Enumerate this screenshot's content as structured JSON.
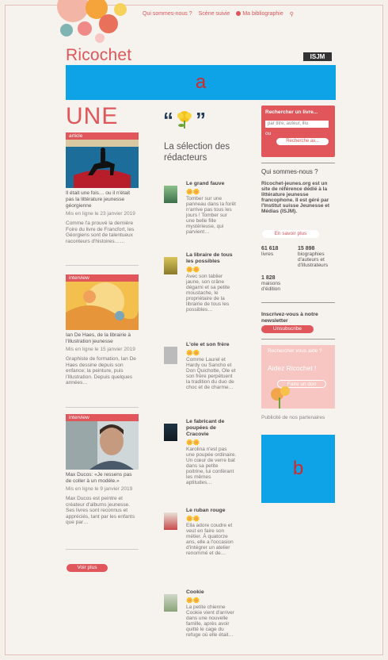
{
  "site": {
    "nav": [
      "Qui sommes-nous ?",
      "Scène suivie",
      "Ma bibliographie"
    ],
    "logo": "Ricochet",
    "partner_badge": "ISJM",
    "ad_top": "a",
    "ad_side": "b"
  },
  "une": {
    "heading": "UNE",
    "cards": [
      {
        "tag": "article",
        "title": "Il était une fois… ou il n'était pas la littérature jeunesse géorgienne",
        "date": "Mis en ligne le 23 janvier 2019",
        "desc": "Comme l'a prouvé la dernière Foire du livre de Francfort, les Géorgiens sont de talentueux raconteurs d'histoires……"
      },
      {
        "tag": "interview",
        "title": "Ian De Haes, de la librairie à l'illustration jeunesse",
        "date": "Mis en ligne le 15 janvier 2019",
        "desc": "Graphiste de formation, Ian De Haes dessine depuis son enfance; la peinture, puis l'illustration. Depuis quelques années…"
      },
      {
        "tag": "interview",
        "title": "Max Ducos: «Je ressens pas de coller à un modèle.»",
        "date": "Mis en ligne le 9 janvier 2019",
        "desc": "Max Ducos est peintre et créateur d'albums jeunesse. Ses livres sont reconnus et appréciés, tant par les enfants que par…"
      }
    ],
    "more_button": "Voir plus"
  },
  "selection": {
    "title": "La sélection des rédacteurs",
    "items": [
      {
        "title": "Le grand fauve",
        "flowers": "🌼🌼",
        "desc": "Tomber sur une panneau dans la forêt n'arrive pas tous les jours ! Tomber sur une belle fille mystérieuse, qui parvient…"
      },
      {
        "title": "La libraire de tous les possibles",
        "flowers": "🌼🌼",
        "desc": "Avec son tablier jaune, son crâne dégarni et sa petite moustache, le propriétaire de la librairie de tous les possibles…"
      },
      {
        "title": "L'ole et son frère",
        "flowers": "🌼🌼",
        "desc": "Comme Laurel et Hardy ou Sancho et Don Quichotte, Ole et son frère perpétuent la tradition du duo de choc et de charme…"
      },
      {
        "title": "Le fabricant de poupées de Cracovie",
        "flowers": "🌼🌼",
        "desc": "Karolina n'est pas une poupée ordinaire. Un cœur de verre bat dans sa petite poitrine, lui conférant les mêmes aptitudes…"
      },
      {
        "title": "Le ruban rouge",
        "flowers": "🌼🌼",
        "desc": "Ella adore coudre et veut en faire son métier. À quatorze ans, elle a l'occasion d'intégrer un atelier renommé et de…"
      },
      {
        "title": "Cookie",
        "flowers": "🌼🌼",
        "desc": "La petite chienne Cookie vient d'arriver dans une nouvelle famille, après avoir quitté le cage du refuge où elle était…"
      }
    ]
  },
  "sidebar": {
    "search_title": "Rechercher un livre...",
    "search_placeholder": "par titre, auteur, illu",
    "or": "ou",
    "advanced": "Recherche av...",
    "who_title": "Qui sommes-nous ?",
    "who_desc": "Ricochet-jeunes.org est un site de référence dédié à la littérature jeunesse francophone. Il est géré par l'Institut suisse Jeunesse et Médias (ISJM).",
    "who_more": "En savoir plus",
    "stats": [
      {
        "n": "61 618",
        "l": "livres"
      },
      {
        "n": "15 898",
        "l": "biographies d'auteurs et d'illustrateurs"
      },
      {
        "n": "1 828",
        "l": "maisons d'édition"
      }
    ],
    "newsletter": "Inscrivez-vous à notre newsletter",
    "subscribe": "Unsubscribe",
    "don_small": "Rechercher vous aide ?",
    "don_big": "Aidez Ricochet !",
    "don_button": "Faire un don",
    "ads_label": "Publicité de nos partenaires"
  }
}
